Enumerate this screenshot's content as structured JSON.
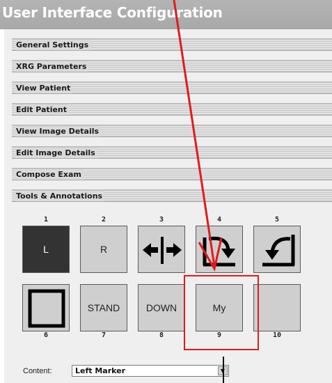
{
  "window": {
    "title": "User Interface Configuration"
  },
  "sections": [
    {
      "label": "General Settings"
    },
    {
      "label": "XRG Parameters"
    },
    {
      "label": "View Patient"
    },
    {
      "label": "Edit Patient"
    },
    {
      "label": "View Image Details"
    },
    {
      "label": "Edit Image Details"
    },
    {
      "label": "Compose Exam"
    },
    {
      "label": "Tools & Annotations"
    }
  ],
  "tools": [
    {
      "number": "1",
      "label": "L",
      "icon": "text",
      "selected": true
    },
    {
      "number": "2",
      "label": "R",
      "icon": "text"
    },
    {
      "number": "3",
      "label": "",
      "icon": "flip-horizontal-icon"
    },
    {
      "number": "4",
      "label": "",
      "icon": "rotate-clockwise-icon"
    },
    {
      "number": "5",
      "label": "",
      "icon": "rotate-counterclockwise-icon"
    },
    {
      "number": "6",
      "label": "",
      "icon": "rectangle-icon"
    },
    {
      "number": "7",
      "label": "STAND",
      "icon": "text"
    },
    {
      "number": "8",
      "label": "DOWN",
      "icon": "text"
    },
    {
      "number": "9",
      "label": "My",
      "icon": "text",
      "highlighted": true
    },
    {
      "number": "10",
      "label": "",
      "icon": "empty"
    }
  ],
  "content": {
    "label": "Content:",
    "value": "Left Marker",
    "dropdown_icon": "chevron-down-icon"
  },
  "annotation": {
    "color": "#e01b1b",
    "icon": "red-pointer-arrow"
  },
  "colors": {
    "title_bar": "#ababab",
    "selected_tool": "#333333",
    "tool_bg": "#cfcfcf"
  }
}
